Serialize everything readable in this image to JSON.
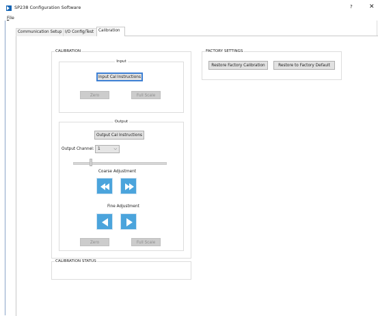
{
  "window": {
    "title": "SP238 Configuration Software",
    "help_label": "?",
    "close_label": "✕"
  },
  "menu": {
    "file_first": "F",
    "file_rest": "ile"
  },
  "tabs": [
    {
      "label": "Communication Setup"
    },
    {
      "label": "I/O Config/Test"
    },
    {
      "label": "Calibration"
    }
  ],
  "calibration": {
    "group_title": "CALIBRATION",
    "input": {
      "title": "Input",
      "instructions_label": "Input Cal Instructions",
      "zero_label": "Zero",
      "full_scale_label": "Full Scale"
    },
    "output": {
      "title": "Output",
      "instructions_label": "Output Cal Instructions",
      "channel_label": "Output Channel:",
      "channel_value": "1",
      "slider_level": 0.18,
      "coarse_label": "Coarse Adjustment",
      "fine_label": "Fine Adjustment",
      "zero_label": "Zero",
      "full_scale_label": "Full Scale"
    }
  },
  "factory": {
    "group_title": "FACTORY SETTINGS",
    "restore_cal_label": "Restore Factory Calibration",
    "restore_default_label": "Restore to Factory Default"
  },
  "status": {
    "group_title": "CALIBRATION STATUS"
  },
  "colors": {
    "accent": "#4ba4dc",
    "focus": "#3c7fd4",
    "disabled_text": "#8d8d8d"
  }
}
